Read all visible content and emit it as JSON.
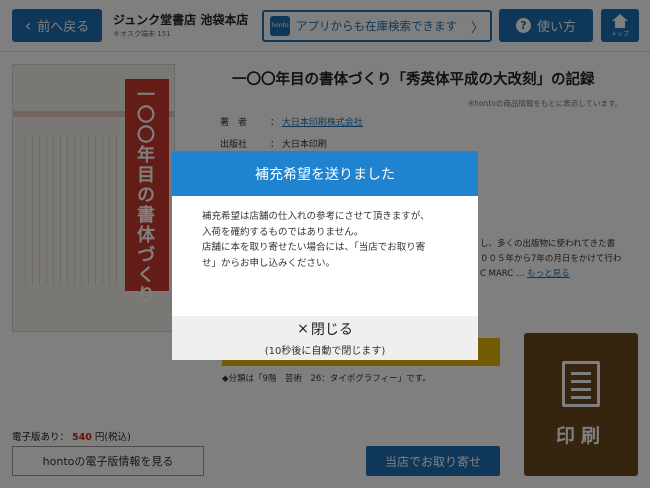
{
  "header": {
    "back_label": "前へ戻る",
    "store_name": "ジュンク堂書店 池袋本店",
    "kiosk_label": "キオスク端末 151",
    "app_icon_text": "honto",
    "app_search_label": "アプリからも在庫検索できます",
    "howto_label": "使い方",
    "top_label": "トップ"
  },
  "book": {
    "cover_title": "一〇〇年目の書体づくり",
    "title": "一〇〇年目の書体づくり「秀英体平成の大改刻」の記録",
    "hint": "※hontoの商品情報をもとに表示しています。",
    "author_key": "著　者",
    "author_sep": "：",
    "author_value": "大日本印刷株式会社",
    "publisher_key": "出版社",
    "publisher_sep": "：",
    "publisher_value": "大日本印刷",
    "desc_line1": "し、多くの出版物に使われてきた書",
    "desc_line2": "００５年から7年の月日をかけて行わ",
    "desc_line3_prefix": "C MARC …",
    "more_link": "もっと見る",
    "category": "◆分類は「9階　芸術　26：タイポグラフィー」です。"
  },
  "actions": {
    "print_label": "印刷",
    "ebook_prefix": "電子版あり：",
    "ebook_price": "540",
    "ebook_suffix": "円(税込)",
    "honto_button": "hontoの電子版情報を見る",
    "order_button": "当店でお取り寄せ"
  },
  "modal": {
    "title": "補充希望を送りました",
    "body_line1": "補充希望は店舗の仕入れの参考にさせて頂きますが、",
    "body_line2": "入荷を確約するものではありません。",
    "body_line3": "店舗に本を取り寄せたい場合には、「当店でお取り寄",
    "body_line4": "せ」からお申し込みください。",
    "close_label": "閉じる",
    "close_sub": "(10秒後に自動で閉じます)"
  },
  "colors": {
    "primary_blue": "#1f6fb3",
    "modal_header": "#1f83cf",
    "print_brown": "#6b4a1f",
    "price_red": "#d9230f",
    "accent_yellow": "#e8b400"
  }
}
